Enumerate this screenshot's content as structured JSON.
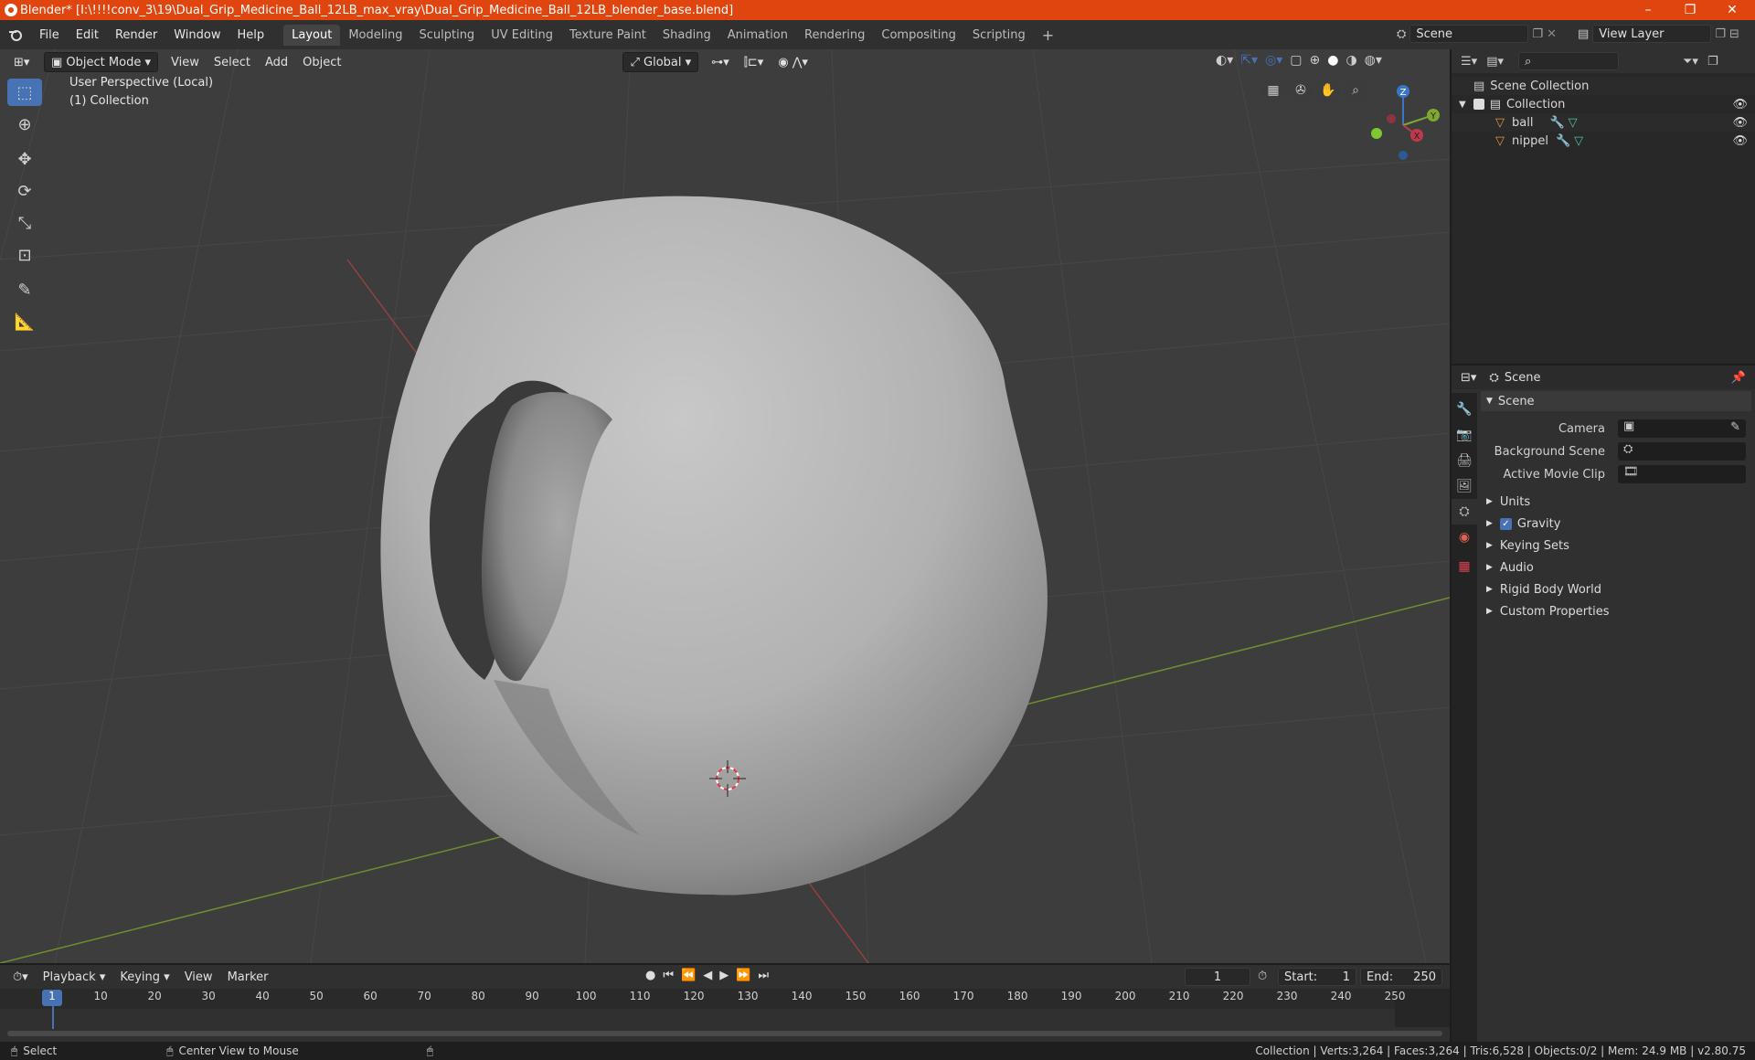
{
  "window": {
    "title": "Blender* [I:\\!!!!conv_3\\19\\Dual_Grip_Medicine_Ball_12LB_max_vray\\Dual_Grip_Medicine_Ball_12LB_blender_base.blend]",
    "minimize": "–",
    "maximize": "❐",
    "close": "✕"
  },
  "menubar": {
    "file": "File",
    "edit": "Edit",
    "render": "Render",
    "window": "Window",
    "help": "Help"
  },
  "workspaces": [
    "Layout",
    "Modeling",
    "Sculpting",
    "UV Editing",
    "Texture Paint",
    "Shading",
    "Animation",
    "Rendering",
    "Compositing",
    "Scripting"
  ],
  "scene_field": "Scene",
  "view_layer_field": "View Layer",
  "viewport": {
    "mode": "Object Mode",
    "menus": {
      "view": "View",
      "select": "Select",
      "add": "Add",
      "object": "Object"
    },
    "transform_orientation": "Global",
    "overlay_line1": "User Perspective (Local)",
    "overlay_line2": "(1) Collection",
    "gizmo": {
      "z": "Z",
      "y": "Y",
      "x": "X"
    }
  },
  "outliner": {
    "root": "Scene Collection",
    "collection": "Collection",
    "objects": [
      "ball",
      "nippel"
    ]
  },
  "properties": {
    "header": "Scene",
    "section": "Scene",
    "fields": {
      "camera": "Camera",
      "background_scene": "Background Scene",
      "active_movie_clip": "Active Movie Clip"
    },
    "panels": {
      "units": "Units",
      "gravity": "Gravity",
      "keying_sets": "Keying Sets",
      "audio": "Audio",
      "rigid_body_world": "Rigid Body World",
      "custom_properties": "Custom Properties"
    },
    "gravity_checked": true
  },
  "timeline": {
    "playback": "Playback",
    "keying": "Keying",
    "view": "View",
    "marker": "Marker",
    "current_frame": "1",
    "start_label": "Start:",
    "start_value": "1",
    "end_label": "End:",
    "end_value": "250",
    "ruler_ticks": [
      "1",
      "10",
      "20",
      "30",
      "40",
      "50",
      "60",
      "70",
      "80",
      "90",
      "100",
      "110",
      "120",
      "130",
      "140",
      "150",
      "160",
      "170",
      "180",
      "190",
      "200",
      "210",
      "220",
      "230",
      "240",
      "250"
    ]
  },
  "statusbar": {
    "select": "Select",
    "center_view": "Center View to Mouse",
    "stats": "Collection | Verts:3,264 | Faces:3,264 | Tris:6,528 | Objects:0/2 | Mem: 24.9 MB | v2.80.75"
  },
  "colors": {
    "titlebar": "#e1450f",
    "accent_blue": "#4772b3",
    "viewport_bg": "#3d3d3d",
    "axis_x": "#c0394b",
    "axis_y": "#7fa832",
    "axis_z": "#3a76c8"
  }
}
